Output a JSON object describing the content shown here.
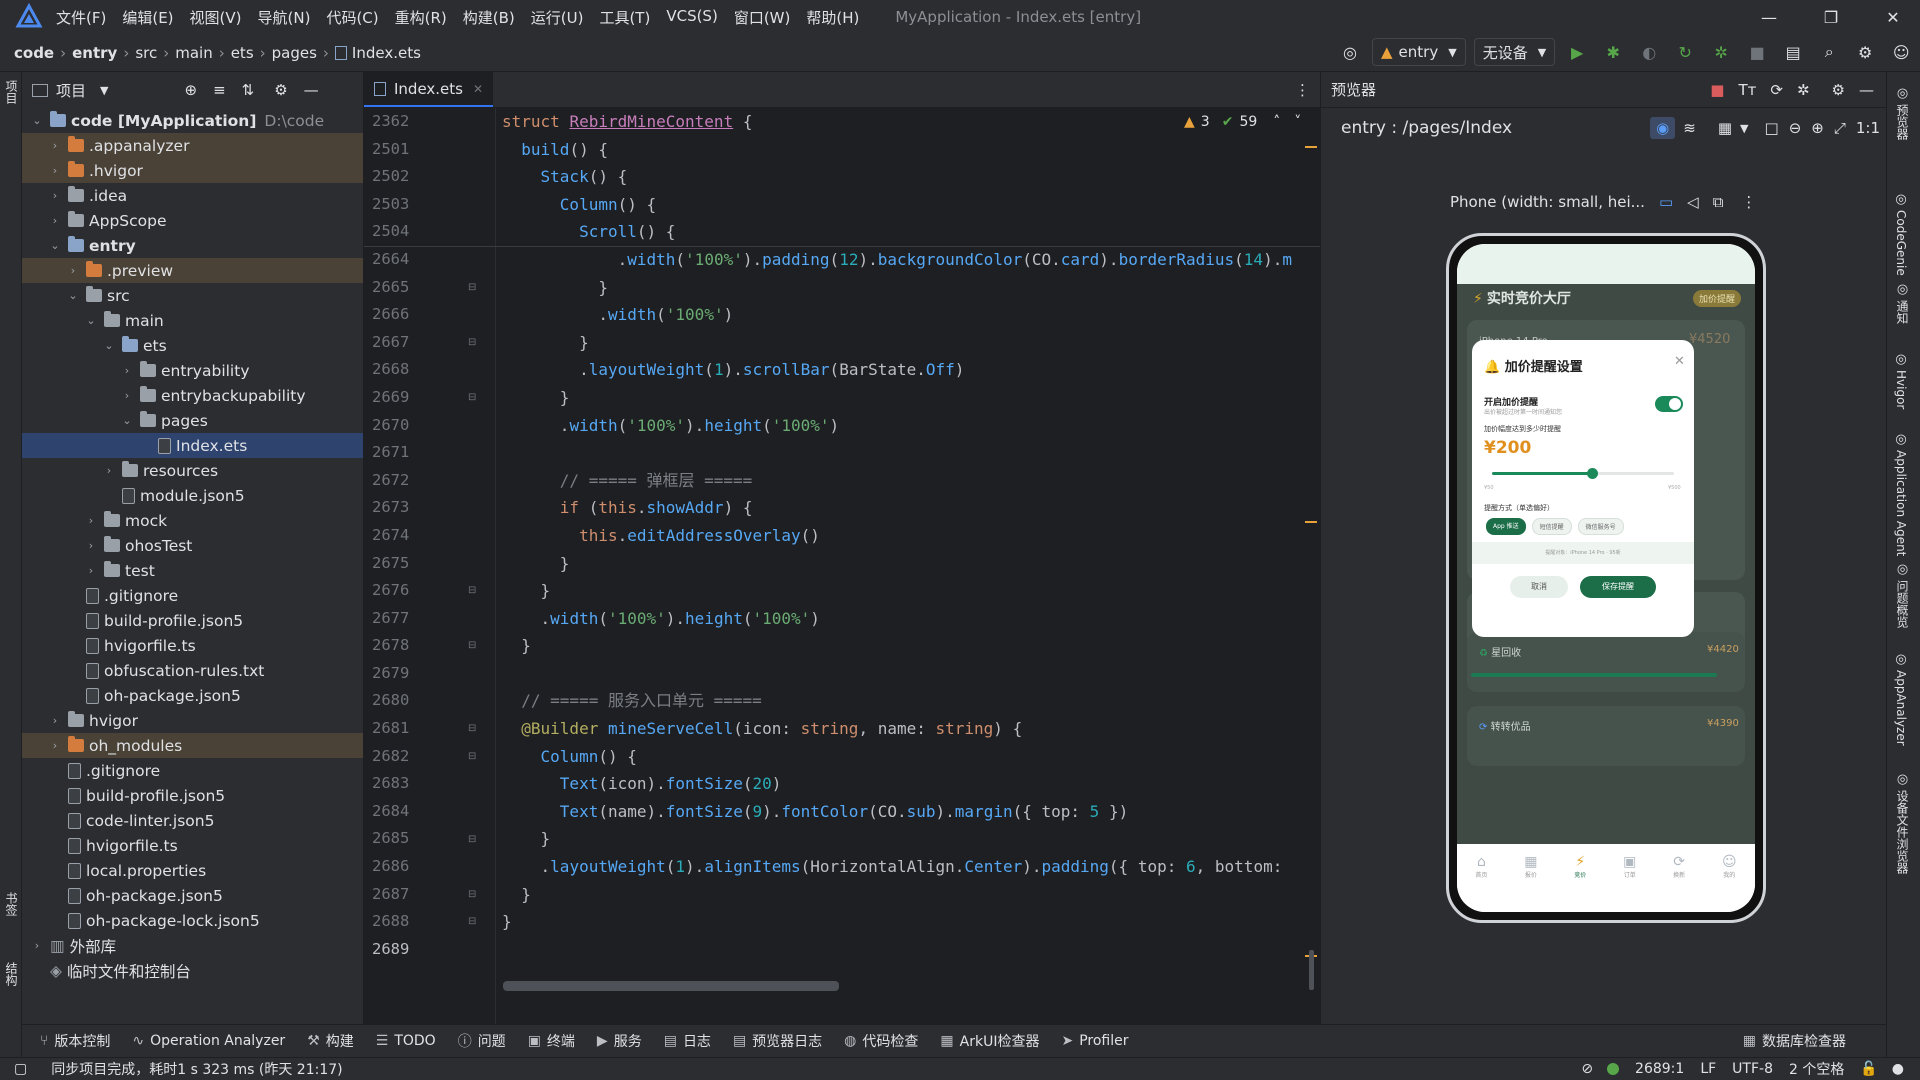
{
  "menubar": {
    "items": [
      "文件(F)",
      "编辑(E)",
      "视图(V)",
      "导航(N)",
      "代码(C)",
      "重构(R)",
      "构建(B)",
      "运行(U)",
      "工具(T)",
      "VCS(S)",
      "窗口(W)",
      "帮助(H)"
    ],
    "title": "MyApplication - Index.ets [entry]"
  },
  "breadcrumb": [
    "code",
    "entry",
    "src",
    "main",
    "ets",
    "pages",
    "Index.ets"
  ],
  "toolbar": {
    "module": "entry",
    "device": "无设备"
  },
  "project": {
    "header": "项目",
    "tree": [
      {
        "label": "code [MyApplication]",
        "extra": "D:\\code",
        "depth": 0,
        "arrow": "open",
        "icon": "folder-blue",
        "bold": true
      },
      {
        "label": ".appanalyzer",
        "depth": 1,
        "arrow": "closed",
        "icon": "folder-orange",
        "hl": "orange"
      },
      {
        "label": ".hvigor",
        "depth": 1,
        "arrow": "closed",
        "icon": "folder-orange",
        "hl": "orange"
      },
      {
        "label": ".idea",
        "depth": 1,
        "arrow": "closed",
        "icon": "folder-gray"
      },
      {
        "label": "AppScope",
        "depth": 1,
        "arrow": "closed",
        "icon": "folder-gray"
      },
      {
        "label": "entry",
        "depth": 1,
        "arrow": "open",
        "icon": "folder-blue",
        "bold": true
      },
      {
        "label": ".preview",
        "depth": 2,
        "arrow": "closed",
        "icon": "folder-orange",
        "hl": "orange"
      },
      {
        "label": "src",
        "depth": 2,
        "arrow": "open",
        "icon": "folder-gray"
      },
      {
        "label": "main",
        "depth": 3,
        "arrow": "open",
        "icon": "folder-gray"
      },
      {
        "label": "ets",
        "depth": 4,
        "arrow": "open",
        "icon": "folder-blue"
      },
      {
        "label": "entryability",
        "depth": 5,
        "arrow": "closed",
        "icon": "folder-gray"
      },
      {
        "label": "entrybackupability",
        "depth": 5,
        "arrow": "closed",
        "icon": "folder-gray"
      },
      {
        "label": "pages",
        "depth": 5,
        "arrow": "open",
        "icon": "folder-gray"
      },
      {
        "label": "Index.ets",
        "depth": 6,
        "arrow": "none",
        "icon": "file",
        "sel": true
      },
      {
        "label": "resources",
        "depth": 4,
        "arrow": "closed",
        "icon": "folder-gray"
      },
      {
        "label": "module.json5",
        "depth": 4,
        "arrow": "none",
        "icon": "file"
      },
      {
        "label": "mock",
        "depth": 3,
        "arrow": "closed",
        "icon": "folder-gray"
      },
      {
        "label": "ohosTest",
        "depth": 3,
        "arrow": "closed",
        "icon": "folder-gray"
      },
      {
        "label": "test",
        "depth": 3,
        "arrow": "closed",
        "icon": "folder-gray"
      },
      {
        "label": ".gitignore",
        "depth": 2,
        "arrow": "none",
        "icon": "file"
      },
      {
        "label": "build-profile.json5",
        "depth": 2,
        "arrow": "none",
        "icon": "file"
      },
      {
        "label": "hvigorfile.ts",
        "depth": 2,
        "arrow": "none",
        "icon": "file"
      },
      {
        "label": "obfuscation-rules.txt",
        "depth": 2,
        "arrow": "none",
        "icon": "file"
      },
      {
        "label": "oh-package.json5",
        "depth": 2,
        "arrow": "none",
        "icon": "file"
      },
      {
        "label": "hvigor",
        "depth": 1,
        "arrow": "closed",
        "icon": "folder-gray"
      },
      {
        "label": "oh_modules",
        "depth": 1,
        "arrow": "closed",
        "icon": "folder-orange",
        "hl": "orange"
      },
      {
        "label": ".gitignore",
        "depth": 1,
        "arrow": "none",
        "icon": "file"
      },
      {
        "label": "build-profile.json5",
        "depth": 1,
        "arrow": "none",
        "icon": "file"
      },
      {
        "label": "code-linter.json5",
        "depth": 1,
        "arrow": "none",
        "icon": "file"
      },
      {
        "label": "hvigorfile.ts",
        "depth": 1,
        "arrow": "none",
        "icon": "file"
      },
      {
        "label": "local.properties",
        "depth": 1,
        "arrow": "none",
        "icon": "file"
      },
      {
        "label": "oh-package.json5",
        "depth": 1,
        "arrow": "none",
        "icon": "file"
      },
      {
        "label": "oh-package-lock.json5",
        "depth": 1,
        "arrow": "none",
        "icon": "file"
      },
      {
        "label": "外部库",
        "depth": 0,
        "arrow": "closed",
        "icon": "lib"
      },
      {
        "label": "临时文件和控制台",
        "depth": 0,
        "arrow": "none",
        "icon": "console"
      }
    ]
  },
  "editor": {
    "tab": "Index.ets",
    "warnings": "3",
    "checks": "59",
    "lines": [
      {
        "n": "2362",
        "c": "struct RebirdMineContent {"
      },
      {
        "n": "2501",
        "c": "  build() {"
      },
      {
        "n": "2502",
        "c": "    Stack() {"
      },
      {
        "n": "2503",
        "c": "      Column() {"
      },
      {
        "n": "2504",
        "c": "        Scroll() {"
      },
      {
        "n": "2664",
        "c": "            .width('100%').padding(12).backgroundColor(CO.card).borderRadius(14).m"
      },
      {
        "n": "2665",
        "c": "          }"
      },
      {
        "n": "2666",
        "c": "          .width('100%')"
      },
      {
        "n": "2667",
        "c": "        }"
      },
      {
        "n": "2668",
        "c": "        .layoutWeight(1).scrollBar(BarState.Off)"
      },
      {
        "n": "2669",
        "c": "      }"
      },
      {
        "n": "2670",
        "c": "      .width('100%').height('100%')"
      },
      {
        "n": "2671",
        "c": ""
      },
      {
        "n": "2672",
        "c": "      // ===== 弹框层 ====="
      },
      {
        "n": "2673",
        "c": "      if (this.showAddr) {"
      },
      {
        "n": "2674",
        "c": "        this.editAddressOverlay()"
      },
      {
        "n": "2675",
        "c": "      }"
      },
      {
        "n": "2676",
        "c": "    }"
      },
      {
        "n": "2677",
        "c": "    .width('100%').height('100%')"
      },
      {
        "n": "2678",
        "c": "  }"
      },
      {
        "n": "2679",
        "c": ""
      },
      {
        "n": "2680",
        "c": "  // ===== 服务入口单元 ====="
      },
      {
        "n": "2681",
        "c": "  @Builder mineServeCell(icon: string, name: string) {"
      },
      {
        "n": "2682",
        "c": "    Column() {"
      },
      {
        "n": "2683",
        "c": "      Text(icon).fontSize(20)"
      },
      {
        "n": "2684",
        "c": "      Text(name).fontSize(9).fontColor(CO.sub).margin({ top: 5 })"
      },
      {
        "n": "2685",
        "c": "    }"
      },
      {
        "n": "2686",
        "c": "    .layoutWeight(1).alignItems(HorizontalAlign.Center).padding({ top: 6, bottom:"
      },
      {
        "n": "2687",
        "c": "  }"
      },
      {
        "n": "2688",
        "c": "}"
      },
      {
        "n": "2689",
        "c": ""
      }
    ]
  },
  "preview": {
    "header": "预览器",
    "route": "entry : /pages/Index",
    "device": "Phone (width: small, hei...",
    "phone": {
      "page_title": "实时竞价大厅",
      "page_badge": "加价提醒",
      "card1_name": "iPhone 14 Pro",
      "card1_price": "¥4520",
      "dialog": {
        "title": "加价提醒设置",
        "toggle_label": "开启加价提醒",
        "toggle_sub": "出价被超过时第一时间通知您",
        "threshold_label": "加价幅度达到多少时提醒",
        "amount": "¥200",
        "slider_value": 0.55,
        "slider_min": "¥50",
        "slider_max": "¥500",
        "method_label": "提醒方式（单选偏好）",
        "methods": [
          "App 推送",
          "短信提醒",
          "微信服务号"
        ],
        "target": "提醒对象：iPhone 14 Pro · 95新",
        "cancel": "取消",
        "save": "保存提醒"
      },
      "shop1_name": "星回收",
      "shop1_price": "¥4420",
      "shop2_name": "转转优品",
      "shop2_price": "¥4390",
      "nav": [
        "首页",
        "报价",
        "竞价",
        "订单",
        "换新",
        "我的"
      ]
    }
  },
  "bottom_tools": [
    "版本控制",
    "Operation Analyzer",
    "构建",
    "TODO",
    "问题",
    "终端",
    "服务",
    "日志",
    "预览器日志",
    "代码检查",
    "ArkUI检查器",
    "Profiler"
  ],
  "bottom_right": "数据库检查器",
  "status": {
    "message": "同步项目完成，耗时1 s 323 ms (昨天 21:17)",
    "position": "2689:1",
    "line_sep": "LF",
    "encoding": "UTF-8",
    "indent": "2 个空格"
  },
  "right_strip": [
    "预览器",
    "CodeGenie",
    "通知",
    "Hvigor",
    "Application Agent",
    "问题概览",
    "AppAnalyzer",
    "设备文件浏览器"
  ],
  "left_strip": [
    "项目",
    "书签",
    "结构"
  ],
  "colors": {
    "accent": "#3574f0",
    "phone_green": "#1b7a52",
    "warning": "#e9a23b"
  }
}
